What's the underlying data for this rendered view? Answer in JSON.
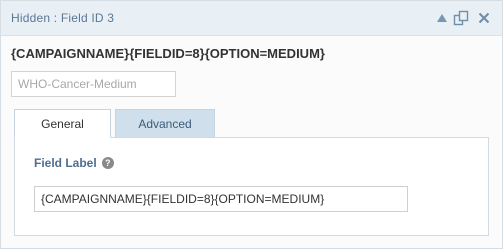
{
  "header": {
    "title": "Hidden : Field ID 3",
    "icons": [
      "collapse-up-icon",
      "duplicate-icon",
      "close-icon"
    ]
  },
  "field": {
    "merge_tag": "{CAMPAIGNNAME}{FIELDID=8}{OPTION=MEDIUM}",
    "default_value": "WHO-Cancer-Medium"
  },
  "tabs": [
    {
      "label": "General",
      "active": true
    },
    {
      "label": "Advanced",
      "active": false
    }
  ],
  "general": {
    "field_label_title": "Field Label",
    "help_glyph": "?",
    "field_label_value": "{CAMPAIGNNAME}{FIELDID=8}{OPTION=MEDIUM}"
  },
  "colors": {
    "titlebar_bg": "#e8eff5",
    "title_text": "#5a7896",
    "inactive_tab_bg": "#cfdfec",
    "label_accent": "#4f6e8e"
  }
}
